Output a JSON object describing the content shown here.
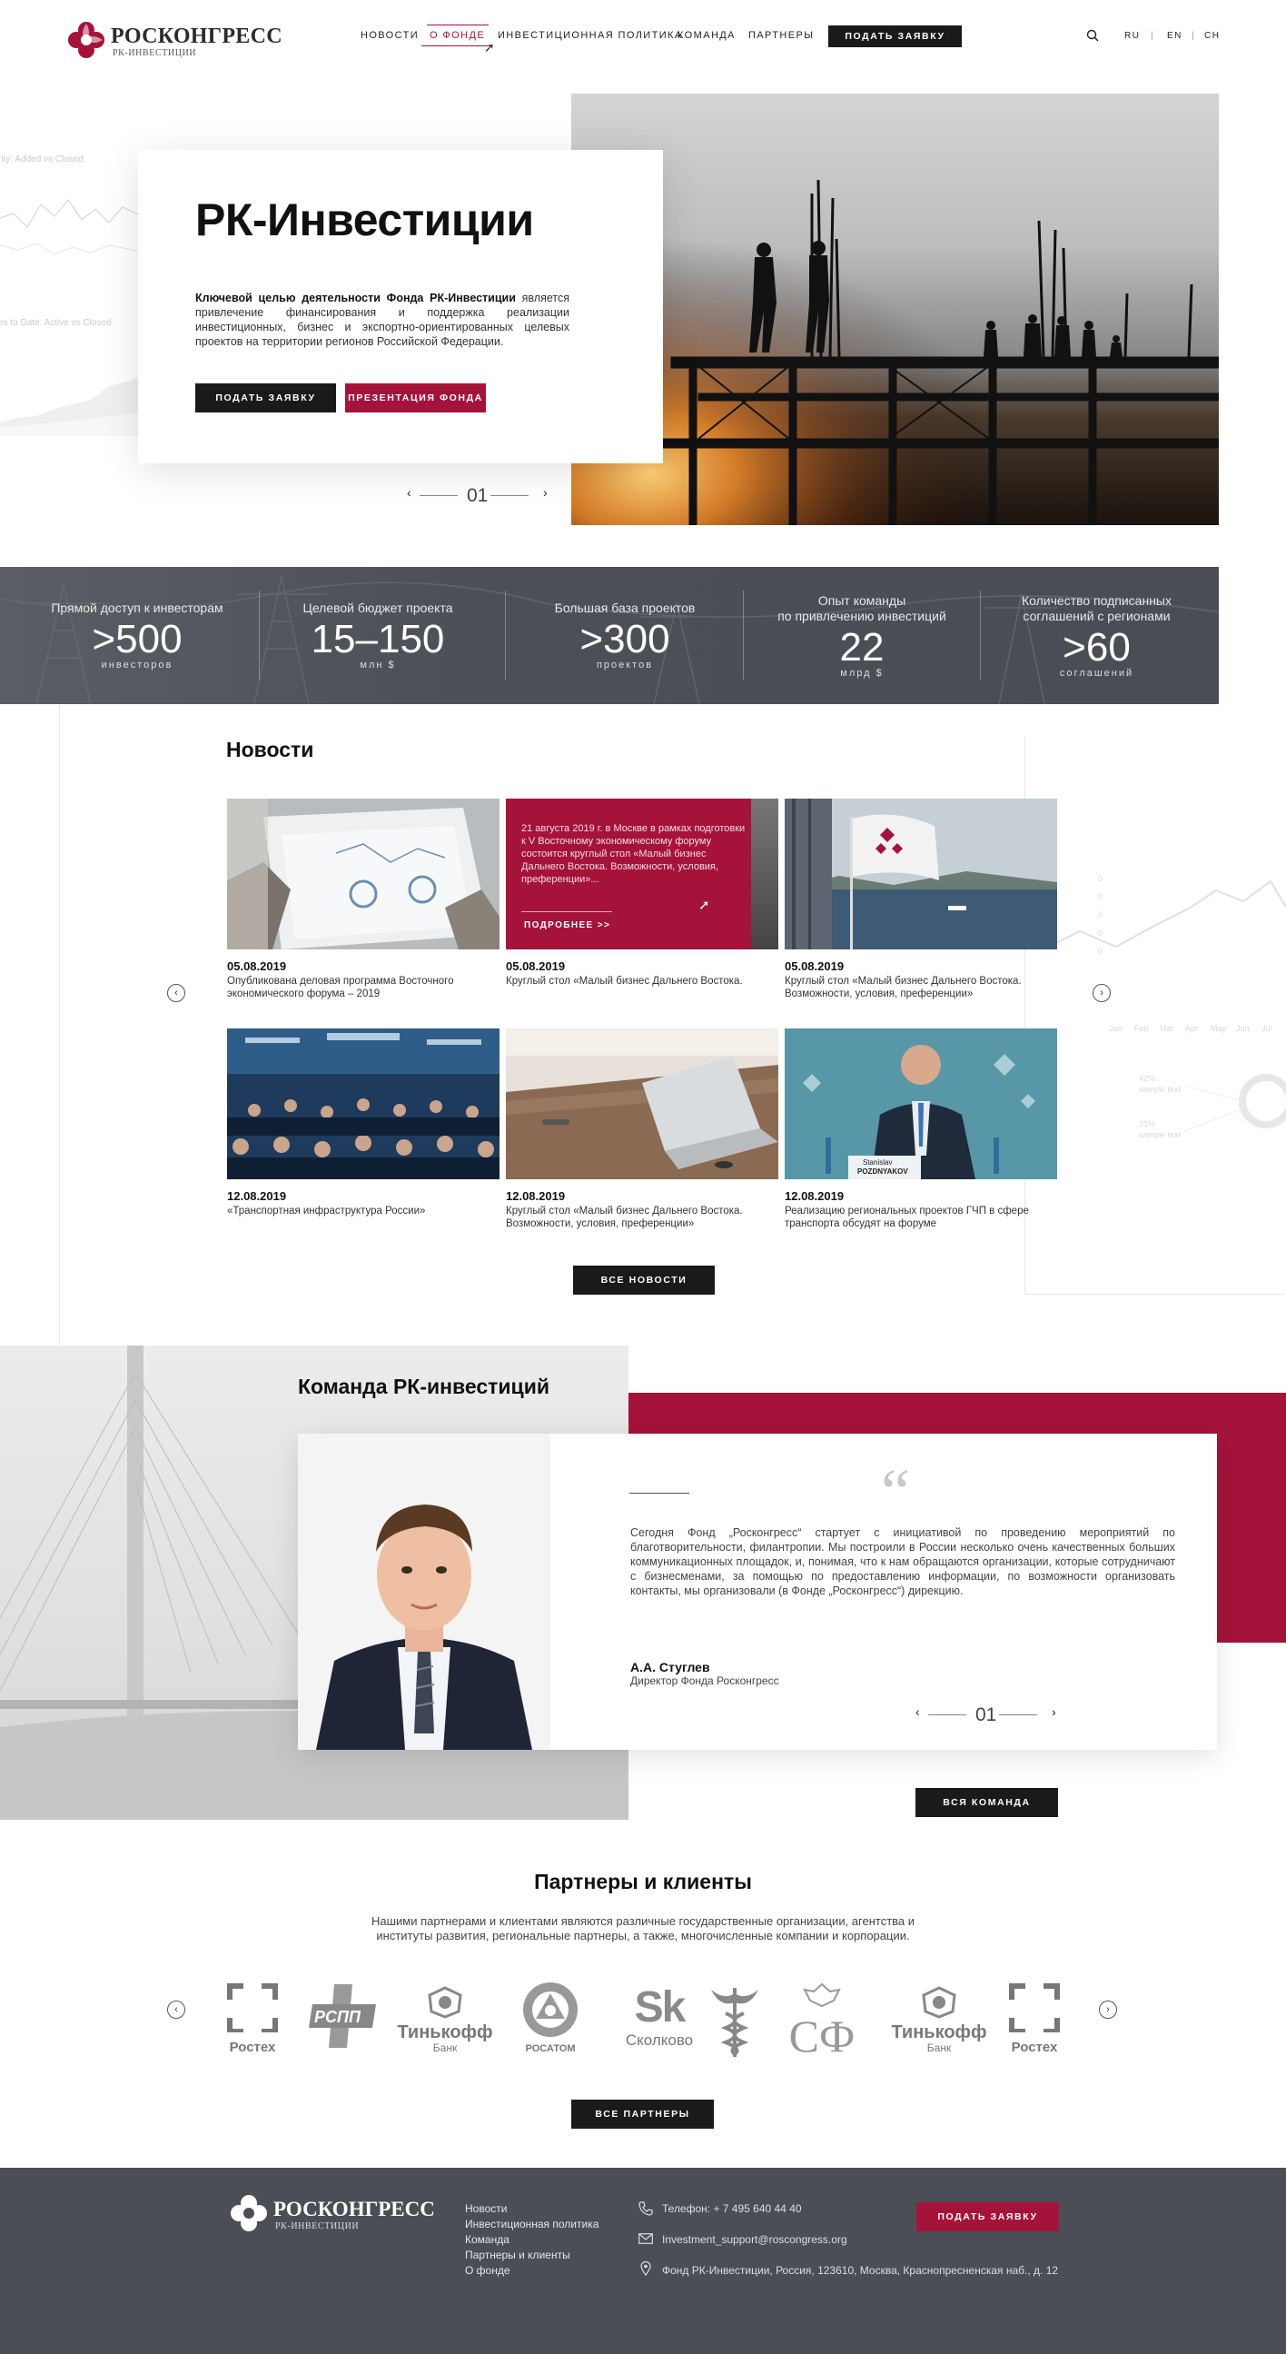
{
  "header": {
    "brand": "РОСКОНГРЕСС",
    "brand_sub": "РК-ИНВЕСТИЦИИ",
    "nav": [
      "НОВОСТИ",
      "О ФОНДЕ",
      "ИНВЕСТИЦИОННАЯ ПОЛИТИКА",
      "КОМАНДА",
      "ПАРТНЕРЫ"
    ],
    "apply": "ПОДАТЬ ЗАЯВКУ",
    "langs": [
      "RU",
      "EN",
      "CH"
    ],
    "lang_sep": "|"
  },
  "hero": {
    "title": "РК-Инвестиции",
    "lead_bold": "Ключевой целью деятельности Фонда РК-Инвестиции",
    "lead_rest": " является привлечение финансирования и поддержка реализации инвестиционных, бизнес и экспортно-ориентированных целевых проектов на территории регионов Российской Федерации.",
    "btn_apply": "ПОДАТЬ ЗАЯВКУ",
    "btn_presentation": "ПРЕЗЕНТАЦИЯ ФОНДА",
    "slide": "01",
    "bg_chart_1": "rity: Added vs Closed",
    "bg_chart_2": "es to Date: Active vs Closed"
  },
  "stats": [
    {
      "label": "Прямой доступ к инвесторам",
      "value": ">500",
      "unit": "инвесторов"
    },
    {
      "label": "Целевой бюджет проекта",
      "value": "15–150",
      "unit": "млн $"
    },
    {
      "label": "Большая база проектов",
      "value": ">300",
      "unit": "проектов"
    },
    {
      "label": "Опыт команды\nпо привлечению инвестиций",
      "value": "22",
      "unit": "млрд $"
    },
    {
      "label": "Количество подписанных\nсоглашений с регионами",
      "value": ">60",
      "unit": "соглашений"
    }
  ],
  "news": {
    "title": "Новости",
    "all": "ВСЕ НОВОСТИ",
    "featured_text": "21 августа 2019 г. в Москве в рамках подготовки к V Восточному экономическому форуму состоится круглый стол «Малый бизнес Дальнего Востока. Возможности, условия, преференции»...",
    "featured_more": "ПОДРОБНЕЕ >>",
    "items": [
      {
        "date": "05.08.2019",
        "text": "Опубликована деловая программа Восточного экономического форума – 2019"
      },
      {
        "date": "05.08.2019",
        "text": "Круглый стол «Малый бизнес Дальнего Востока."
      },
      {
        "date": "05.08.2019",
        "text": "Круглый стол «Малый бизнес Дальнего Востока. Возможности, условия, преференции»"
      },
      {
        "date": "12.08.2019",
        "text": "«Транспортная инфраструктура России»"
      },
      {
        "date": "12.08.2019",
        "text": "Круглый стол «Малый бизнес Дальнего Востока. Возможности, условия, преференции»"
      },
      {
        "date": "12.08.2019",
        "text": "Реализацию региональных проектов ГЧП в сфере транспорта обсудят на форуме"
      }
    ],
    "badge_name": "Stanislav",
    "badge_surname": "POZDNYAKOV"
  },
  "team": {
    "title": "Команда РК-инвестиций",
    "quote_mark": "“",
    "quote": "Сегодня Фонд „Росконгресс“ стартует с инициативой по проведению мероприятий по благотворительности, филантропии. Мы построили в России несколько очень качественных больших коммуникационных площадок, и, понимая, что к нам обращаются организации, которые сотрудничают с бизнесменами, за помощью по предоставлению информации, по возможности организовать контакты, мы организовали (в Фонде „Росконгресс“) дирекцию.",
    "name": "А.А. Стуглев",
    "role": "Директор Фонда Росконгресс",
    "slide": "01",
    "all": "ВСЯ КОМАНДА"
  },
  "partners": {
    "title": "Партнеры и клиенты",
    "desc": "Нашими партнерами и клиентами являются различные государственные организации, агентства и институты развития, региональные партнеры, а также, многочисленные компании и корпорации.",
    "logos": [
      {
        "name": "Ростех",
        "sub": ""
      },
      {
        "name": "РСПП",
        "sub": ""
      },
      {
        "name": "Тинькофф",
        "sub": "Банк"
      },
      {
        "name": "РОСАТОМ",
        "sub": ""
      },
      {
        "name": "Sk",
        "sub": "Сколково"
      },
      {
        "name": "",
        "sub": ""
      },
      {
        "name": "СФ",
        "sub": ""
      },
      {
        "name": "Тинькофф",
        "sub": "Банк"
      },
      {
        "name": "Ростех",
        "sub": ""
      }
    ],
    "all": "ВСЕ ПАРТНЕРЫ"
  },
  "footer": {
    "brand": "РОСКОНГРЕСС",
    "brand_sub": "РК-ИНВЕСТИЦИИ",
    "links": [
      "Новости",
      "Инвестиционная политика",
      "Команда",
      "Партнеры и клиенты",
      "О фонде"
    ],
    "phone": "Телефон: + 7 495 640 44 40",
    "email": "Investment_support@roscongress.org",
    "address": "Фонд РК-Инвестиции, Россия, 123610, Москва, Краснопресненская наб., д. 12",
    "apply": "ПОДАТЬ ЗАЯВКУ"
  },
  "colors": {
    "accent": "#a5133b",
    "dark": "#1a1a1a",
    "stats_bg": "#4c5056",
    "footer_bg": "#4b4f55"
  }
}
